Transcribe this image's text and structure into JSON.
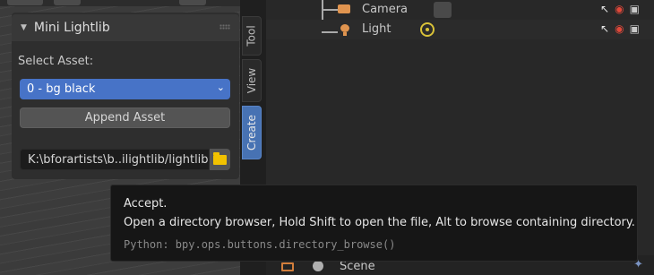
{
  "panel": {
    "title": "Mini Lightlib",
    "select_label": "Select Asset:",
    "dropdown_value": "0 - bg black",
    "append_label": "Append Asset",
    "path_value": "K:\\bforartists\\b..ilightlib/lightlib"
  },
  "tabs": [
    {
      "label": "Tool"
    },
    {
      "label": "View"
    },
    {
      "label": "Create"
    }
  ],
  "outliner": {
    "rows": [
      {
        "label": "Camera"
      },
      {
        "label": "Light"
      }
    ],
    "bottom_label": "Scene"
  },
  "tooltip": {
    "title": "Accept.",
    "description": "Open a directory browser, Hold Shift to open the file, Alt to browse containing directory.",
    "python": "Python: bpy.ops.buttons.directory_browse()"
  },
  "colors": {
    "accent": "#4772b3",
    "dropdown": "#4773c7",
    "folder": "#f2c200",
    "object_icon": "#e0944f"
  }
}
